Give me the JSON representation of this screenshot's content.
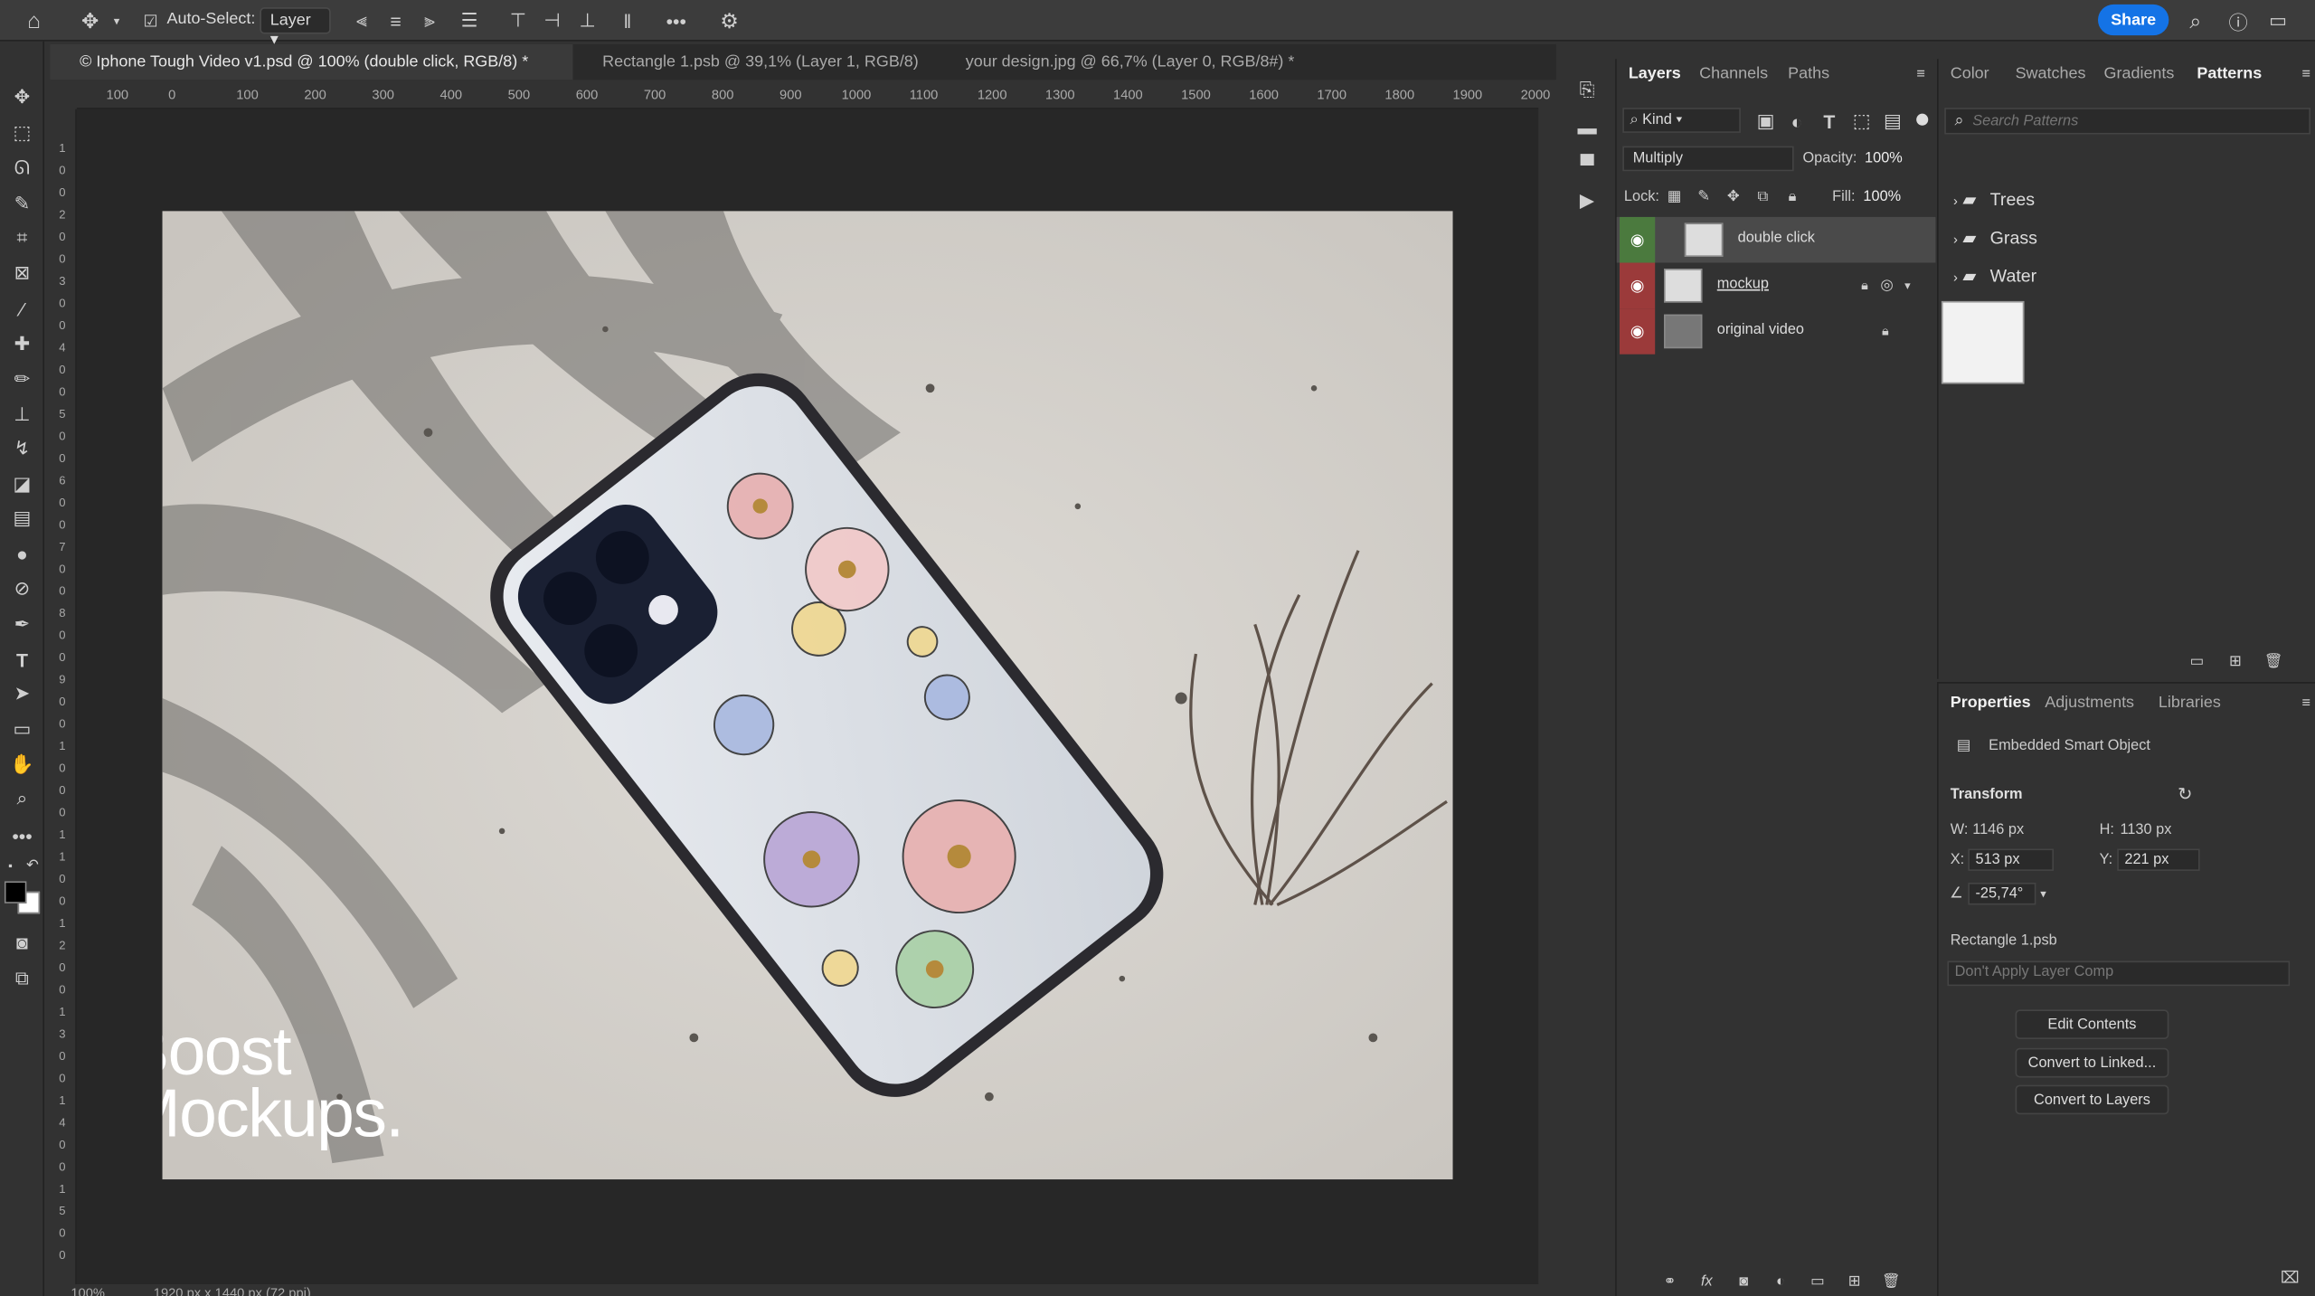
{
  "options_bar": {
    "auto_select_label": "Auto-Select:",
    "auto_select_value": "Layer",
    "share_label": "Share"
  },
  "tabs": [
    {
      "label": "© Iphone Tough Video v1.psd @ 100% (double click, RGB/8) *"
    },
    {
      "label": "Rectangle 1.psb @ 39,1% (Layer 1, RGB/8)"
    },
    {
      "label": "your design.jpg @ 66,7% (Layer 0, RGB/8#) *"
    }
  ],
  "ruler_h": [
    "100",
    "0",
    "100",
    "200",
    "300",
    "400",
    "500",
    "600",
    "700",
    "800",
    "900",
    "1000",
    "1100",
    "1200",
    "1300",
    "1400",
    "1500",
    "1600",
    "1700",
    "1800",
    "1900",
    "2000"
  ],
  "ruler_v": [
    "1",
    "0",
    "0",
    "2",
    "0",
    "0",
    "3",
    "0",
    "0",
    "4",
    "0",
    "0",
    "5",
    "0",
    "0",
    "6",
    "0",
    "0",
    "7",
    "0",
    "0",
    "8",
    "0",
    "0",
    "9",
    "0",
    "0",
    "1",
    "0",
    "0",
    "0",
    "1",
    "1",
    "0",
    "0",
    "1",
    "2",
    "0",
    "0",
    "1",
    "3",
    "0",
    "0",
    "1",
    "4",
    "0",
    "0",
    "1",
    "5",
    "0",
    "0"
  ],
  "watermark": {
    "line1": "Boost",
    "line2": "Mockups.",
    "symbol": "©"
  },
  "status": {
    "zoom": "100%",
    "doc_info": "1920 px x 1440 px (72 ppi)"
  },
  "layers_panel": {
    "tabs": [
      "Layers",
      "Channels",
      "Paths"
    ],
    "filter_kind": "Kind",
    "blend_mode": "Multiply",
    "opacity_label": "Opacity:",
    "opacity_value": "100%",
    "lock_label": "Lock:",
    "fill_label": "Fill:",
    "fill_value": "100%",
    "layers": [
      {
        "name": "double click",
        "selected": true
      },
      {
        "name": "mockup",
        "selected": false
      },
      {
        "name": "original video",
        "selected": false
      }
    ]
  },
  "patterns_panel": {
    "tabs": [
      "Color",
      "Swatches",
      "Gradients",
      "Patterns"
    ],
    "search_placeholder": "Search Patterns",
    "folders": [
      "Trees",
      "Grass",
      "Water"
    ]
  },
  "properties_panel": {
    "tabs": [
      "Properties",
      "Adjustments",
      "Libraries"
    ],
    "object_type": "Embedded Smart Object",
    "transform_label": "Transform",
    "w_label": "W:",
    "w_value": "1146 px",
    "h_label": "H:",
    "h_value": "1130 px",
    "x_label": "X:",
    "x_value": "513 px",
    "y_label": "Y:",
    "y_value": "221 px",
    "angle_value": "-25,74°",
    "linked_file": "Rectangle 1.psb",
    "layer_comp": "Don't Apply Layer Comp",
    "buttons": [
      "Edit Contents",
      "Convert to Linked...",
      "Convert to Layers"
    ]
  },
  "colors": {
    "accent": "#1473e6",
    "panel": "#323232",
    "eye_red": "#9b3a3a",
    "eye_green": "#4b7a3e"
  }
}
